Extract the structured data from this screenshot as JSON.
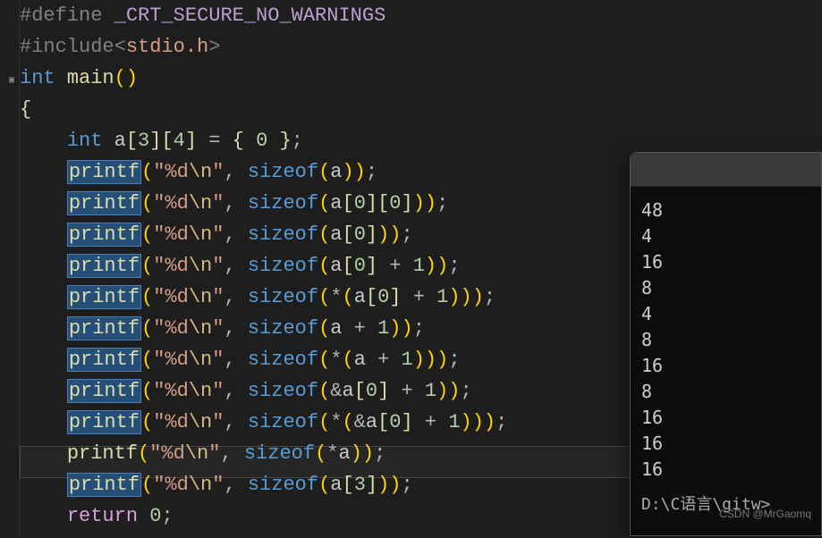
{
  "code": {
    "define_keyword": "#define",
    "define_macro": " _CRT_SECURE_NO_WARNINGS",
    "include_keyword": "#include",
    "include_open": "<",
    "include_path": "stdio.h",
    "include_close": ">",
    "int_type": "int",
    "main_name": " main",
    "parens": "()",
    "open_brace": "{",
    "array_decl_a": "a",
    "array_decl_dim1": "3",
    "array_decl_dim2": "4",
    "equals": " = ",
    "init_open": "{ ",
    "init_val": "0",
    "init_close": " }",
    "printf_name": "printf",
    "fmt_open": "(",
    "fmt_str_prefix": "\"%d",
    "fmt_escape": "\\n",
    "fmt_str_suffix": "\"",
    "sep": ", ",
    "sizeof_kw": "sizeof",
    "close_paren": ")",
    "semi": ";",
    "arg1": "a",
    "arg2_open": "a[",
    "arg2_mid": "][",
    "arg2_close": "]",
    "zero": "0",
    "one": "1",
    "three": "3",
    "plus": " + ",
    "star": "*",
    "amp": "&",
    "return_kw": "return",
    "return_val": " 0"
  },
  "console": {
    "lines": [
      "48",
      "4",
      "16",
      "8",
      "4",
      "8",
      "16",
      "8",
      "16",
      "16",
      "16"
    ],
    "path": "D:\\C语言\\gitw>"
  },
  "watermark": "CSDN @MrGaomq"
}
